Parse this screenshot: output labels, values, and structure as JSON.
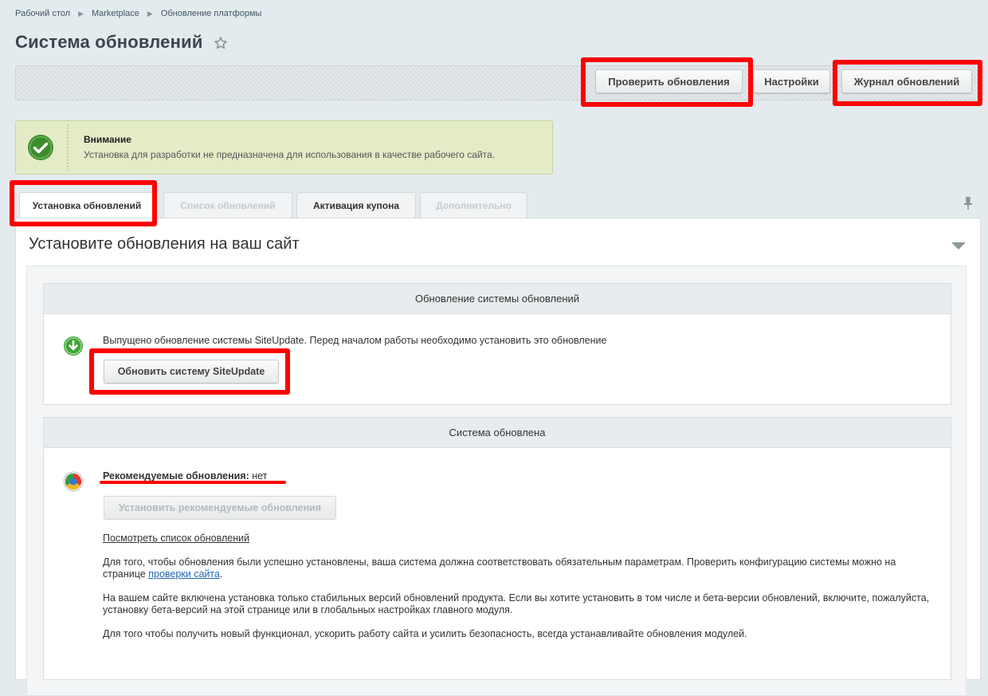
{
  "breadcrumb": [
    "Рабочий стол",
    "Marketplace",
    "Обновление платформы"
  ],
  "page_title": "Система обновлений",
  "toolbar": {
    "check_updates": "Проверить обновления",
    "settings": "Настройки",
    "updates_log": "Журнал обновлений"
  },
  "alert": {
    "title": "Внимание",
    "text": "Установка для разработки не предназначена для использования в качестве рабочего сайта."
  },
  "tabs": [
    {
      "label": "Установка обновлений"
    },
    {
      "label": "Список обновлений"
    },
    {
      "label": "Активация купона"
    },
    {
      "label": "Дополнительно"
    }
  ],
  "panel_title": "Установите обновления на ваш сайт",
  "section1": {
    "header": "Обновление системы обновлений",
    "message": "Выпущено обновление системы SiteUpdate. Перед началом работы необходимо установить это обновление",
    "button": "Обновить систему SiteUpdate"
  },
  "section2": {
    "header": "Система обновлена",
    "recommended_label": "Рекомендуемые обновления:",
    "recommended_value": "нет",
    "install_button": "Установить рекомендуемые обновления",
    "view_list_link": "Посмотреть список обновлений",
    "para1_text": "Для того, чтобы обновления были успешно установлены, ваша система должна соответствовать обязательным параметрам. Проверить конфигурацию системы можно на странице",
    "para1_link": "проверки сайта",
    "para2": "На вашем сайте включена установка только стабильных версий обновлений продукта. Если вы хотите установить в том числе и бета-версии обновлений, включите, пожалуйста, установку бета-версий на этой странице или в глобальных настройках главного модуля.",
    "para3": "Для того чтобы получить новый функционал, ускорить работу сайта и усилить безопасность, всегда устанавливайте обновления модулей."
  },
  "colors": {
    "highlight": "#ff0000",
    "link": "#2067b0",
    "alert_bg": "#e3ecc6",
    "check_green": "#3f8b2e"
  }
}
